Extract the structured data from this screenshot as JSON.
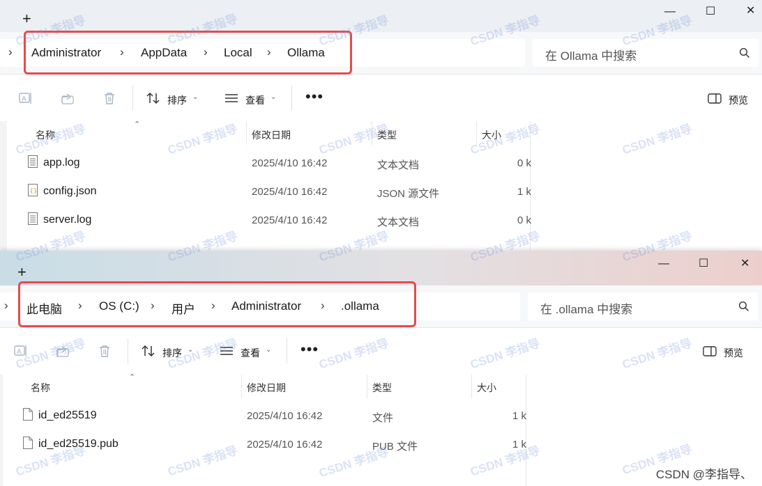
{
  "window1": {
    "breadcrumb": [
      "Administrator",
      "AppData",
      "Local",
      "Ollama"
    ],
    "search_placeholder": "在 Ollama 中搜索",
    "toolbar": {
      "sort_label": "排序",
      "view_label": "查看",
      "more_label": "•••",
      "preview_label": "预览"
    },
    "columns": {
      "name": "名称",
      "modified": "修改日期",
      "type": "类型",
      "size": "大小"
    },
    "files": [
      {
        "name": "app.log",
        "modified": "2025/4/10 16:42",
        "type": "文本文档",
        "size": "0 k"
      },
      {
        "name": "config.json",
        "modified": "2025/4/10 16:42",
        "type": "JSON 源文件",
        "size": "1 k"
      },
      {
        "name": "server.log",
        "modified": "2025/4/10 16:42",
        "type": "文本文档",
        "size": "0 k"
      }
    ]
  },
  "window2": {
    "breadcrumb": [
      "此电脑",
      "OS (C:)",
      "用户",
      "Administrator",
      ".ollama"
    ],
    "search_placeholder": "在 .ollama 中搜索",
    "toolbar": {
      "sort_label": "排序",
      "view_label": "查看",
      "more_label": "•••",
      "preview_label": "预览"
    },
    "columns": {
      "name": "名称",
      "modified": "修改日期",
      "type": "类型",
      "size": "大小"
    },
    "files": [
      {
        "name": "id_ed25519",
        "modified": "2025/4/10 16:42",
        "type": "文件",
        "size": "1 k"
      },
      {
        "name": "id_ed25519.pub",
        "modified": "2025/4/10 16:42",
        "type": "PUB 文件",
        "size": "1 k"
      }
    ]
  },
  "watermark": "CSDN 李指导",
  "credit": "CSDN @李指导、",
  "highlight_color": "#e54b4b"
}
